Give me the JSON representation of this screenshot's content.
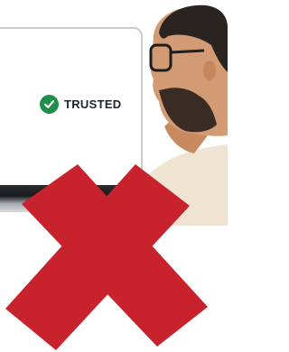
{
  "badge": {
    "label": "TRUSTED",
    "icon": "check-circle-icon",
    "icon_color": "#1f8f4a"
  },
  "overlay": {
    "icon": "red-x-icon",
    "color": "#c8232c"
  }
}
